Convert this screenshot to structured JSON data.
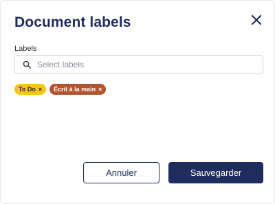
{
  "dialog": {
    "title": "Document labels",
    "close_icon": "close-icon"
  },
  "labels_field": {
    "label": "Labels",
    "placeholder": "Select labels",
    "value": "",
    "icon": "search-icon"
  },
  "selected_labels": [
    {
      "label": "To Do",
      "remove": "×",
      "color": "#f5c518",
      "text_color": "#2a2a2a"
    },
    {
      "label": "Écrit à la main",
      "remove": "×",
      "color": "#b0552f",
      "text_color": "#ffffff"
    }
  ],
  "actions": {
    "cancel_label": "Annuler",
    "save_label": "Sauvegarder"
  },
  "colors": {
    "primary": "#1f2d5c",
    "border": "#d3d6dd"
  }
}
